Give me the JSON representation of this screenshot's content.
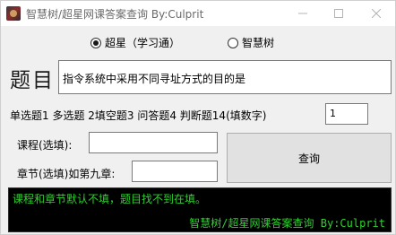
{
  "window": {
    "title": "智慧树/超星网课答案查询   By:Culprit"
  },
  "platform": {
    "options": [
      {
        "label": "超星（学习通）",
        "checked": true
      },
      {
        "label": "智慧树",
        "checked": false
      }
    ]
  },
  "question": {
    "label": "题目",
    "value": "指令系统中采用不同寻址方式的目的是"
  },
  "question_type": {
    "label": "单选题1 多选题 2填空题3 问答题4 判断题14(填数字)",
    "value": "1"
  },
  "course": {
    "label": "课程(选填):",
    "value": ""
  },
  "chapter": {
    "label": "章节(选填)如第九章:",
    "value": ""
  },
  "query_button": {
    "label": "查询"
  },
  "console": {
    "line1": "课程和章节默认不填，题目找不到在填。",
    "line2": "智慧树/超星网课答案查询  By:Culprit",
    "text_color": "#2fd12f",
    "background": "#000000"
  }
}
